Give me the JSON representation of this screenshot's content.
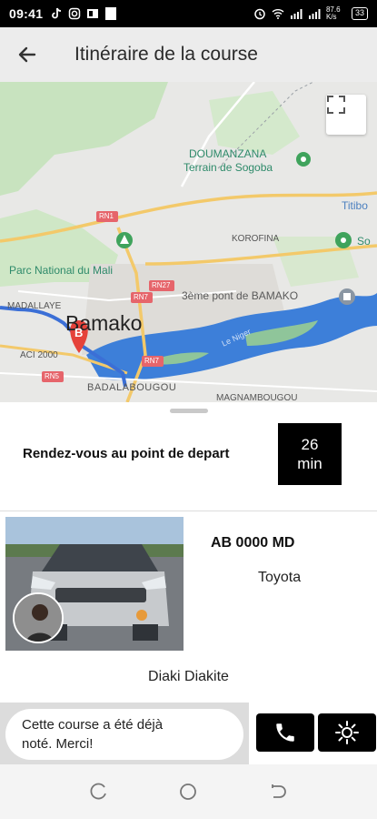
{
  "status_bar": {
    "time": "09:41",
    "network_speed": "87.6 K/s",
    "battery": "33"
  },
  "header": {
    "title": "Itinéraire de la course"
  },
  "map": {
    "city": "Bamako",
    "marker_letter": "B",
    "labels": {
      "doumanzana": "DOUMANZANA",
      "terrain": "Terrain de Sogoba",
      "titibo": "Titibo",
      "so": "So",
      "korofina": "KOROFINA",
      "parc": "Parc National du Mali",
      "pont": "3ème pont de BAMAKO",
      "niger": "Le Niger",
      "madallaye": "MADALLAYE",
      "aci": "ACI 2000",
      "badalabougou": "BADALABOUGOU",
      "magnambougou": "MAGNAMBOUGOU",
      "rn1": "RN1",
      "rn27": "RN27",
      "rn7a": "RN7",
      "rn7b": "RN7",
      "rn5": "RN5"
    }
  },
  "meeting": {
    "text": "Rendez-vous au point de depart",
    "eta_value": "26",
    "eta_unit": "min"
  },
  "vehicle": {
    "plate": "AB 0000 MD",
    "brand": "Toyota",
    "driver_name": "Diaki Diakite"
  },
  "note": {
    "line1": "Cette course a été déjà",
    "line2": "noté. Merci!"
  },
  "colors": {
    "river": "#3d7fd9",
    "route": "#3b6fd6",
    "park": "#b9dcae",
    "marker": "#e5423a"
  }
}
